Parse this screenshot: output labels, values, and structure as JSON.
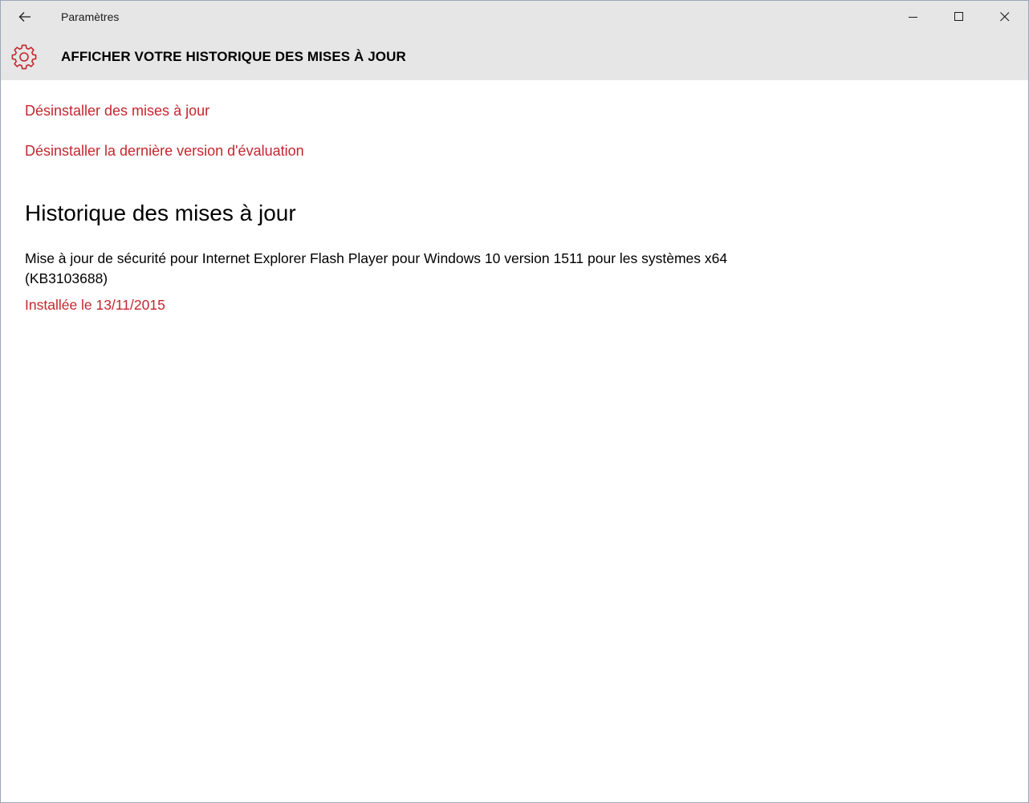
{
  "window": {
    "app_title": "Paramètres",
    "controls": {
      "back": "back-arrow-icon",
      "minimize": "minimize-icon",
      "maximize": "maximize-icon",
      "close": "close-icon"
    }
  },
  "header": {
    "icon": "gear-icon",
    "title": "AFFICHER VOTRE HISTORIQUE DES MISES À JOUR"
  },
  "links": {
    "uninstall_updates": "Désinstaller des mises à jour",
    "uninstall_preview": "Désinstaller la dernière version d'évaluation"
  },
  "history": {
    "section_title": "Historique des mises à jour",
    "updates": [
      {
        "name": "Mise à jour de sécurité pour Internet Explorer Flash Player pour Windows 10 version 1511 pour les systèmes x64 (KB3103688)",
        "status": "Installée le 13/11/2015"
      }
    ]
  },
  "colors": {
    "accent": "#c4262e",
    "chrome": "#e6e6e6",
    "text": "#000000"
  }
}
